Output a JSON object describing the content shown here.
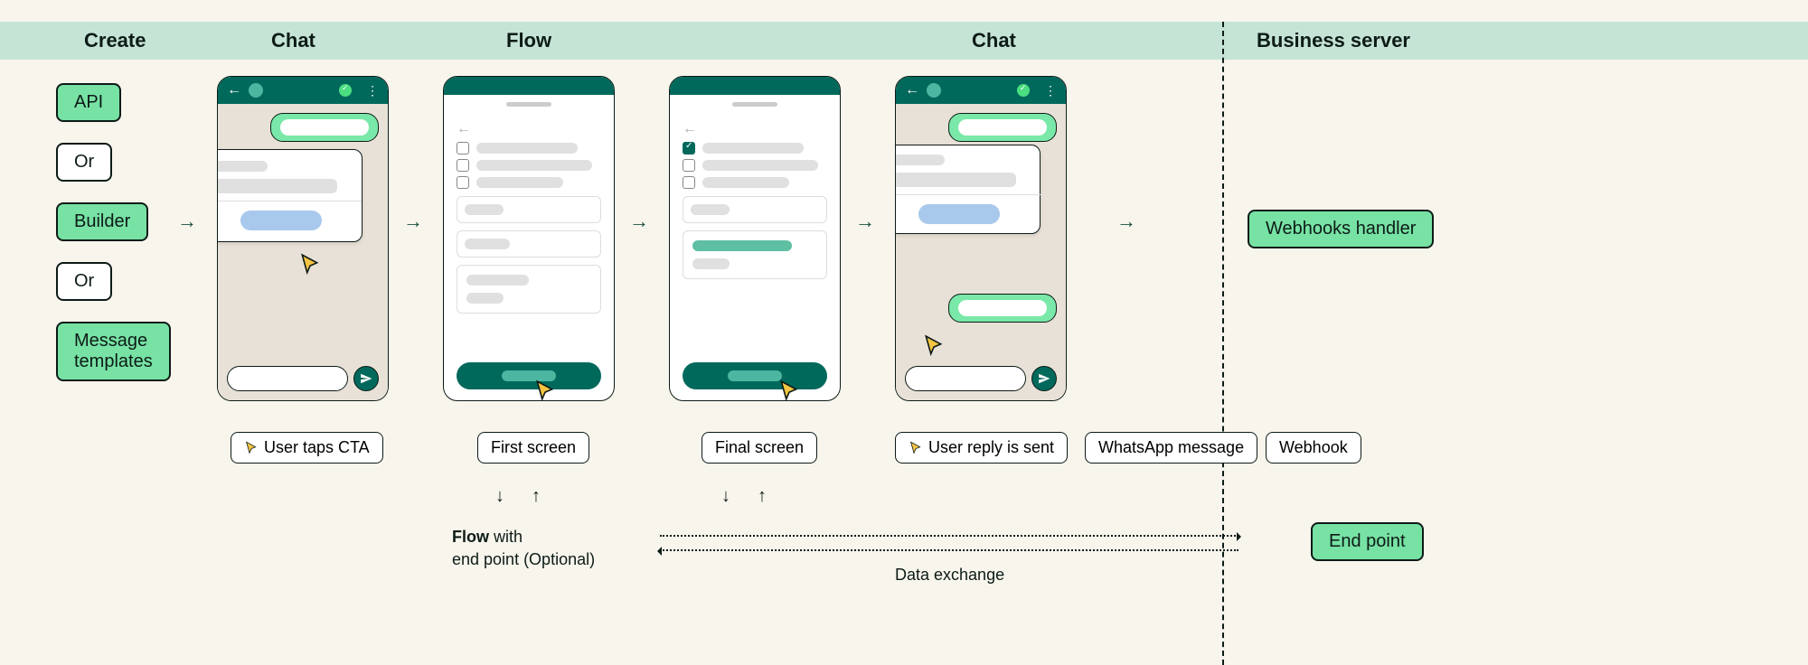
{
  "headers": {
    "create": "Create",
    "chat1": "Chat",
    "flow": "Flow",
    "chat2": "Chat",
    "server": "Business server"
  },
  "create_column": {
    "api": "API",
    "or1": "Or",
    "builder": "Builder",
    "or2": "Or",
    "templates": "Message\ntemplates"
  },
  "captions": {
    "user_taps": "User taps CTA",
    "first_screen": "First screen",
    "final_screen": "Final screen",
    "user_reply": "User reply is sent",
    "wa_message": "WhatsApp message",
    "webhook": "Webhook"
  },
  "flow_note": {
    "line1_strong": "Flow",
    "line1_rest": " with",
    "line2": "end point (Optional)"
  },
  "server_column": {
    "webhooks_handler": "Webhooks handler",
    "endpoint": "End point"
  },
  "exchange_label": "Data exchange",
  "icons": {
    "cursor": "cursor-icon",
    "arrow_right": "arrow-right-icon",
    "arrow_down": "arrow-down-icon",
    "arrow_up": "arrow-up-icon",
    "send": "send-icon",
    "back": "back-icon",
    "checkmark": "check-icon"
  }
}
